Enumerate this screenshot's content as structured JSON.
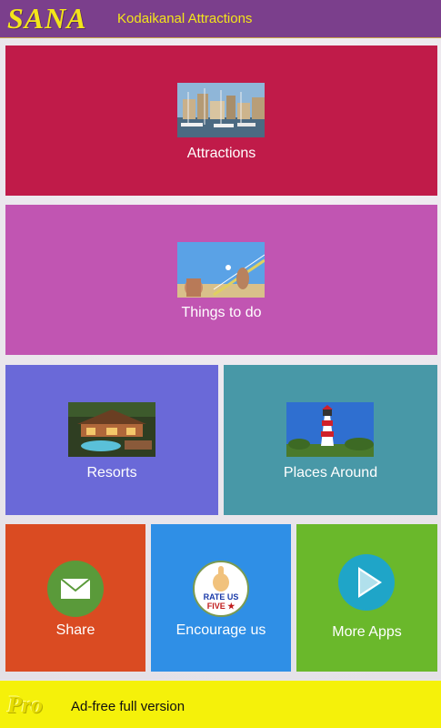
{
  "app": {
    "logo": "SANA",
    "title": "Kodaikanal Attractions"
  },
  "tiles": {
    "attractions": {
      "label": "Attractions",
      "image": "harbor-photo",
      "color": "#c01b49"
    },
    "things_to_do": {
      "label": "Things to do",
      "image": "volleyball-photo",
      "color": "#c155b2"
    },
    "resorts": {
      "label": "Resorts",
      "image": "resort-photo",
      "color": "#6a69d8"
    },
    "places_around": {
      "label": "Places Around",
      "image": "lighthouse-photo",
      "color": "#4898a7"
    },
    "share": {
      "label": "Share",
      "icon": "mail-icon",
      "color": "#da4b22"
    },
    "encourage": {
      "label": "Encourage us",
      "icon": "rate-us-badge",
      "badge_line1": "RATE US",
      "badge_line2": "FIVE ★",
      "color": "#2f8fe6"
    },
    "more_apps": {
      "label": "More Apps",
      "icon": "play-store-icon",
      "color": "#6ab82b"
    }
  },
  "pro_banner": {
    "badge": "Pro",
    "text": "Ad-free full version",
    "color": "#f5f10a"
  }
}
